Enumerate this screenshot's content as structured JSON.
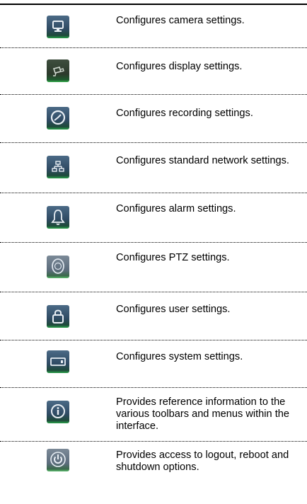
{
  "rows": [
    {
      "icon": "monitor-icon",
      "text": "Configures camera settings."
    },
    {
      "icon": "camera-icon",
      "text": "Configures display settings."
    },
    {
      "icon": "clock-icon",
      "text": "Configures recording settings."
    },
    {
      "icon": "network-icon",
      "text": "Configures standard network settings."
    },
    {
      "icon": "bell-icon",
      "text": "Configures alarm settings."
    },
    {
      "icon": "ptz-dome-icon",
      "text": "Configures PTZ settings."
    },
    {
      "icon": "user-lock-icon",
      "text": "Configures user settings."
    },
    {
      "icon": "dvr-device-icon",
      "text": "Configures system settings."
    },
    {
      "icon": "info-icon",
      "text": "Provides reference information to the various toolbars and menus within the interface."
    },
    {
      "icon": "power-icon",
      "text": "Provides access to logout, reboot and shutdown options."
    }
  ]
}
